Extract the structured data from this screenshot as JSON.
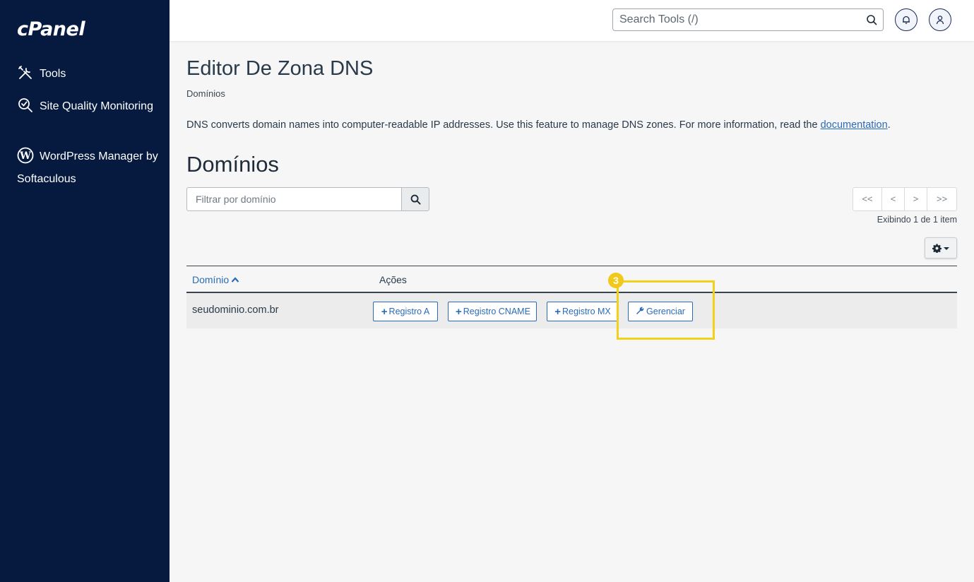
{
  "sidebar": {
    "logo": "cPanel",
    "items": [
      {
        "label": "Tools",
        "icon": "tools-icon"
      },
      {
        "label": "Site Quality Monitoring",
        "icon": "site-quality-icon"
      },
      {
        "label": "WordPress Manager by Softaculous",
        "icon": "wordpress-icon"
      }
    ]
  },
  "topbar": {
    "search_placeholder": "Search Tools (/)"
  },
  "page": {
    "title": "Editor De Zona DNS",
    "breadcrumb": "Domínios",
    "description_prefix": "DNS converts domain names into computer-readable IP addresses. Use this feature to manage DNS zones. For more information, read the ",
    "description_link": "documentation",
    "description_suffix": ".",
    "section_title": "Domínios"
  },
  "filter": {
    "placeholder": "Filtrar por domínio"
  },
  "pagination": {
    "first": "<<",
    "prev": "<",
    "next": ">",
    "last": ">>",
    "showing": "Exibindo 1 de 1 item"
  },
  "table": {
    "headers": {
      "domain": "Domínio",
      "actions": "Ações"
    },
    "rows": [
      {
        "domain": "seudominio.com.br",
        "actions": {
          "a": "Registro A",
          "cname": "Registro CNAME",
          "mx": "Registro MX",
          "manage": "Gerenciar"
        }
      }
    ]
  },
  "annotation": {
    "step": "3",
    "color": "#f2d11a"
  },
  "colors": {
    "sidebar": "#061a40",
    "link": "#2a6bb8"
  }
}
